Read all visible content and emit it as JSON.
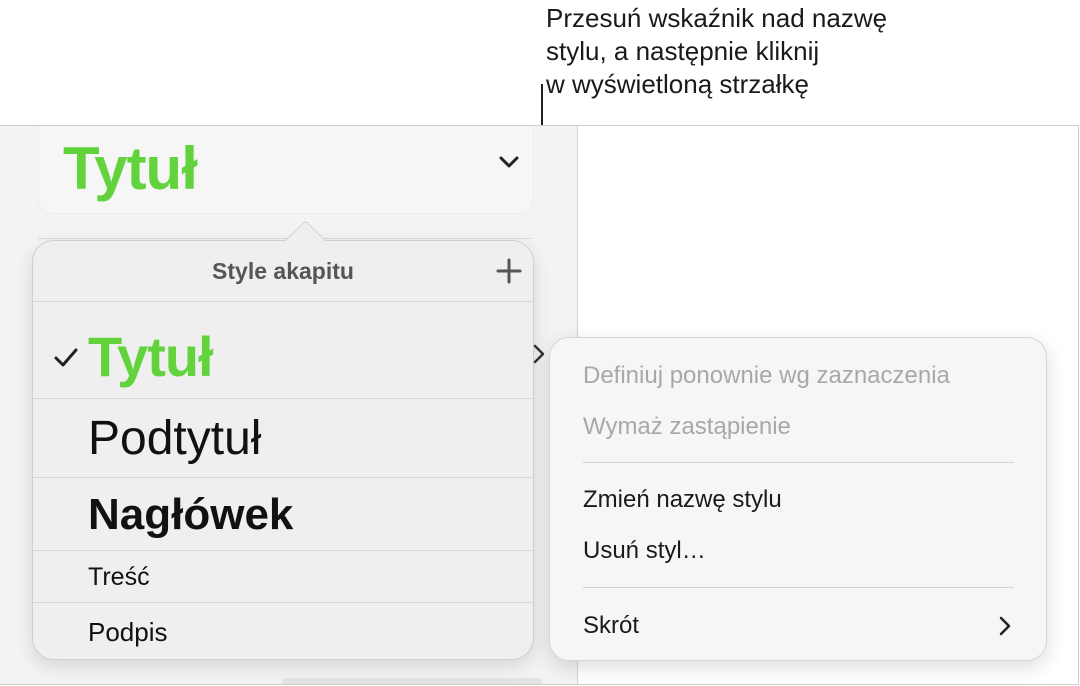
{
  "callout": {
    "text": "Przesuń wskaźnik nad nazwę\nstylu, a następnie kliknij\nw wyświetloną strzałkę"
  },
  "style_selector": {
    "current": "Tytuł",
    "chevron_icon": "chevron-down-icon"
  },
  "styles_popover": {
    "title": "Style akapitu",
    "add_icon": "plus-icon",
    "items": [
      {
        "label": "Tytuł",
        "selected": true,
        "color": "#63d33d"
      },
      {
        "label": "Podtytuł",
        "selected": false
      },
      {
        "label": "Nagłówek",
        "selected": false
      },
      {
        "label": "Treść",
        "selected": false
      },
      {
        "label": "Podpis",
        "selected": false
      }
    ]
  },
  "context_menu": {
    "items": [
      {
        "label": "Definiuj ponownie wg zaznaczenia",
        "enabled": false
      },
      {
        "label": "Wymaż zastąpienie",
        "enabled": false
      },
      {
        "label": "Zmień nazwę stylu",
        "enabled": true
      },
      {
        "label": "Usuń styl…",
        "enabled": true
      },
      {
        "label": "Skrót",
        "enabled": true,
        "submenu": true
      }
    ]
  },
  "colors": {
    "accent_green": "#63d33d",
    "disabled_text": "#a8a8a8"
  }
}
